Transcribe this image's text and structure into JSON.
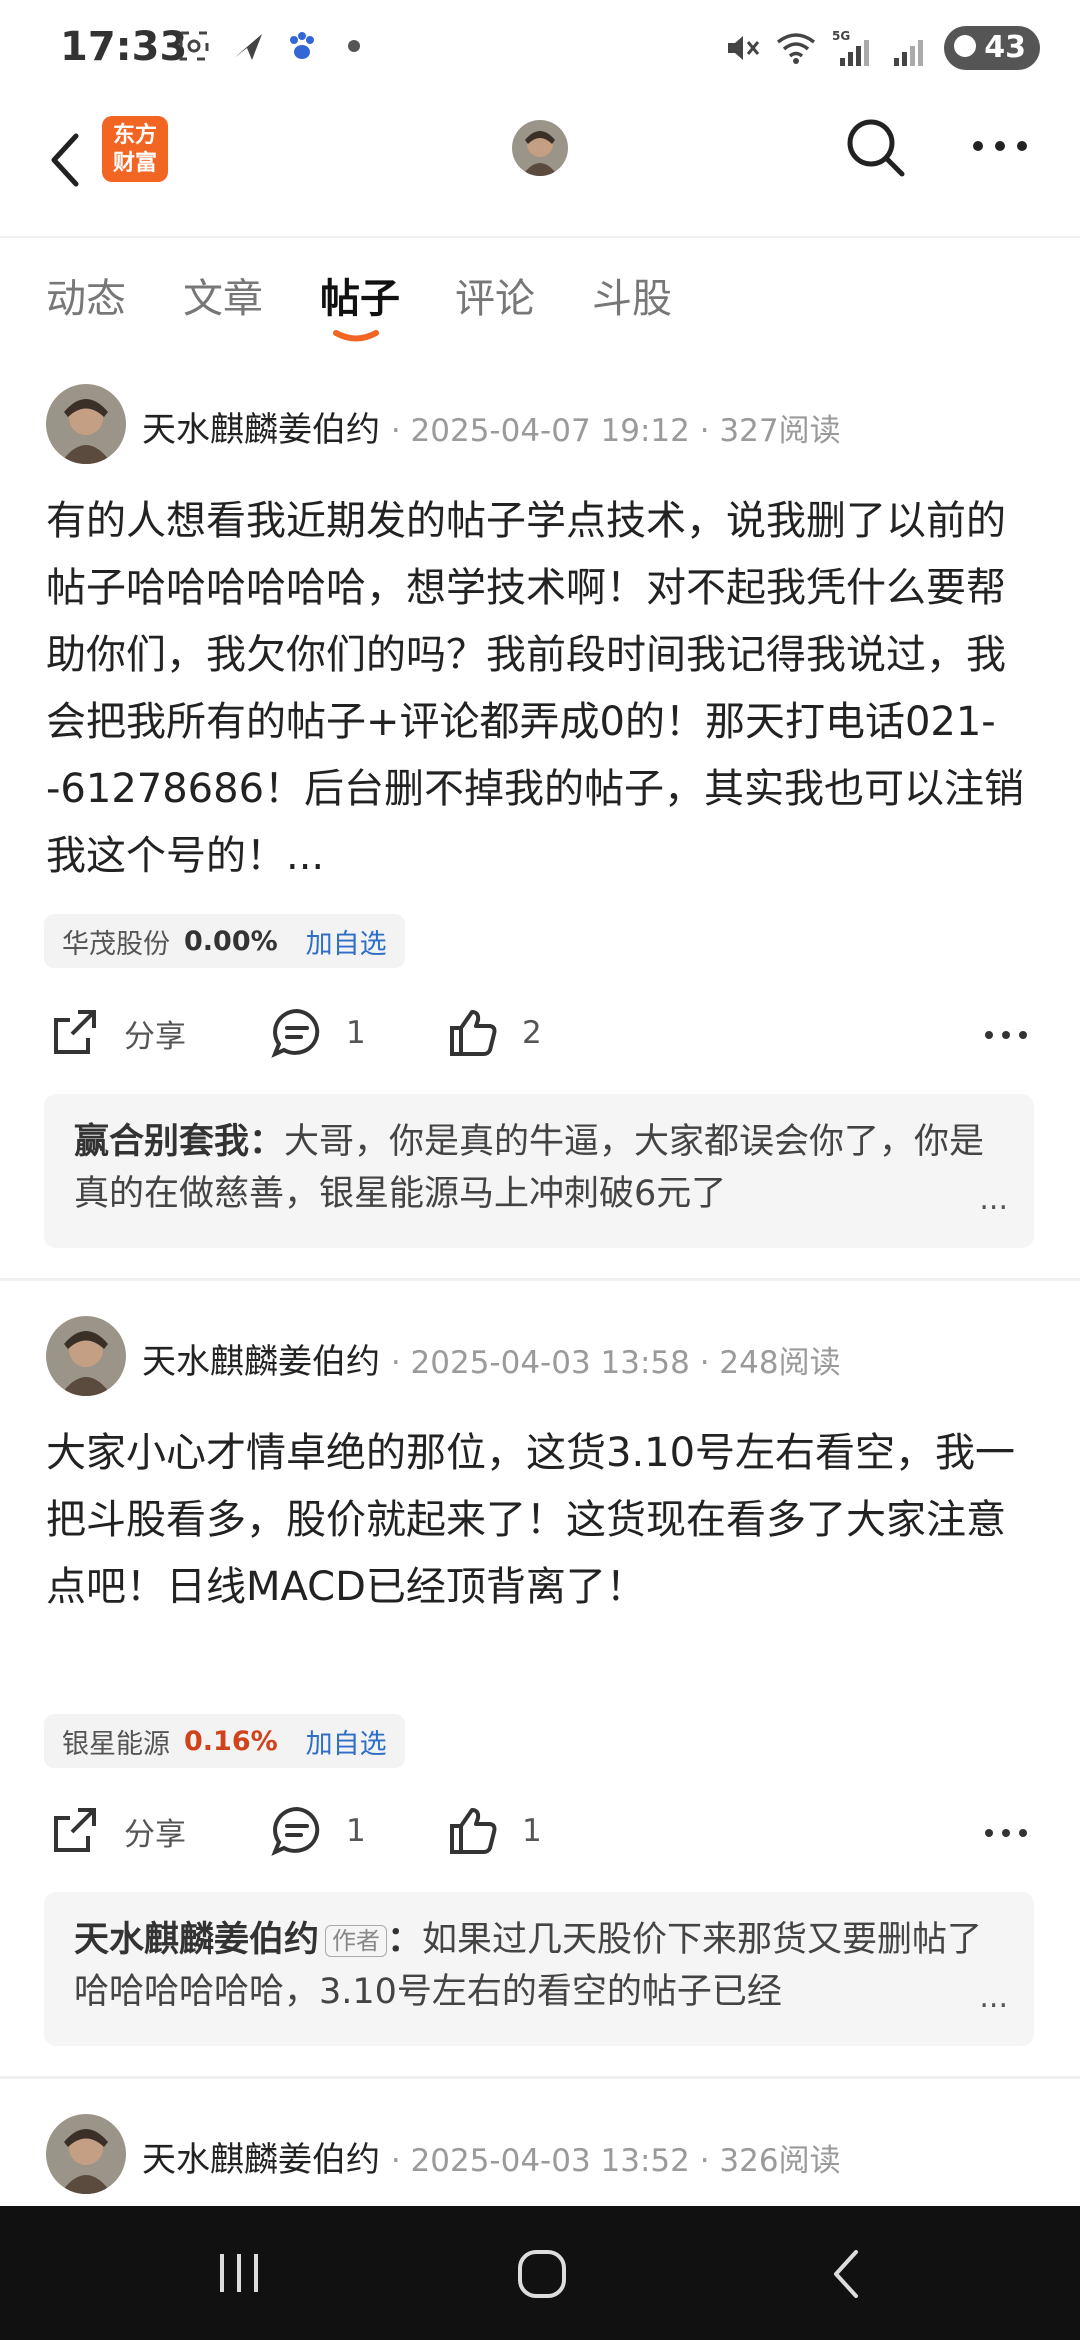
{
  "status_bar": {
    "time": "17:33",
    "battery": "43",
    "network": "5G"
  },
  "header": {
    "logo_line1": "东方",
    "logo_line2": "财富",
    "logo_color": "#f26522"
  },
  "tabs": [
    {
      "label": "动态",
      "active": false
    },
    {
      "label": "文章",
      "active": false
    },
    {
      "label": "帖子",
      "active": true
    },
    {
      "label": "评论",
      "active": false
    },
    {
      "label": "斗股",
      "active": false
    }
  ],
  "accent_color": "#f26522",
  "posts": [
    {
      "author": "天水麒麟姜伯约",
      "meta": "· 2025-04-07 19:12 · 327阅读",
      "body": "有的人想看我近期发的帖子学点技术，说我删了以前的帖子哈哈哈哈哈哈，想学技术啊！对不起我凭什么要帮助你们，我欠你们的吗？我前段时间我记得我说过，我会把我所有的帖子+评论都弄成0的！那天打电话021--61278686！后台删不掉我的帖子，其实我也可以注销我这个号的！...",
      "stock_name": "华茂股份",
      "stock_pct": "0.00%",
      "stock_pct_color": "#333333",
      "stock_add": "加自选",
      "share_label": "分享",
      "comment_count": "1",
      "like_count": "2",
      "comment_author": "赢合别套我：",
      "comment_text": "大哥，你是真的牛逼，大家都误会你了，你是真的在做慈善，银星能源马上冲刺破6元了",
      "comment_more": "..."
    },
    {
      "author": "天水麒麟姜伯约",
      "meta": "· 2025-04-03 13:58 · 248阅读",
      "body": "大家小心才情卓绝的那位，这货3.10号左右看空，我一把斗股看多，股价就起来了！这货现在看多了大家注意点吧！日线MACD已经顶背离了！",
      "stock_name": "银星能源",
      "stock_pct": "0.16%",
      "stock_pct_color": "#d0421b",
      "stock_add": "加自选",
      "share_label": "分享",
      "comment_count": "1",
      "like_count": "1",
      "comment_author": "天水麒麟姜伯约",
      "comment_author_tag": "作者",
      "comment_colon": "：",
      "comment_text": "如果过几天股价下来那货又要删帖了哈哈哈哈哈哈，3.10号左右的看空的帖子已经",
      "comment_more": "..."
    },
    {
      "author": "天水麒麟姜伯约",
      "meta": "· 2025-04-03 13:52 · 326阅读"
    }
  ]
}
